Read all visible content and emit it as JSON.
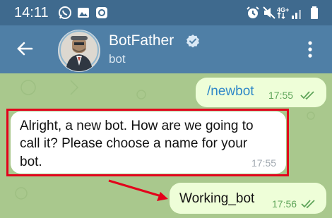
{
  "status_bar": {
    "time": "14:11",
    "network_label": "4G+",
    "icons": [
      "whatsapp-icon",
      "gallery-icon",
      "app-notification-icon",
      "alarm-icon",
      "mute-icon",
      "network-4g-icon",
      "signal-icon",
      "battery-icon"
    ]
  },
  "header": {
    "title": "BotFather",
    "subtitle": "bot",
    "icons": [
      "back-arrow-icon",
      "verified-badge-icon",
      "more-vertical-icon"
    ]
  },
  "messages": [
    {
      "direction": "outgoing",
      "text": "/newbot",
      "time": "17:55",
      "status": "read"
    },
    {
      "direction": "incoming",
      "lines": [
        "Alright, a new bot. How are we going to",
        "call it? Please choose a name for your",
        "bot."
      ],
      "time": "17:55"
    },
    {
      "direction": "outgoing",
      "text": "Working_bot",
      "time": "17:56",
      "status": "read"
    }
  ],
  "annotations": {
    "highlight_color": "#e3001b"
  },
  "colors": {
    "status_bar": "#3f6a8e",
    "app_bar": "#4f7fa6",
    "chat_background": "#a9c88d",
    "outgoing_bubble": "#eefed8",
    "incoming_bubble": "#ffffff",
    "link": "#2e88c8"
  }
}
